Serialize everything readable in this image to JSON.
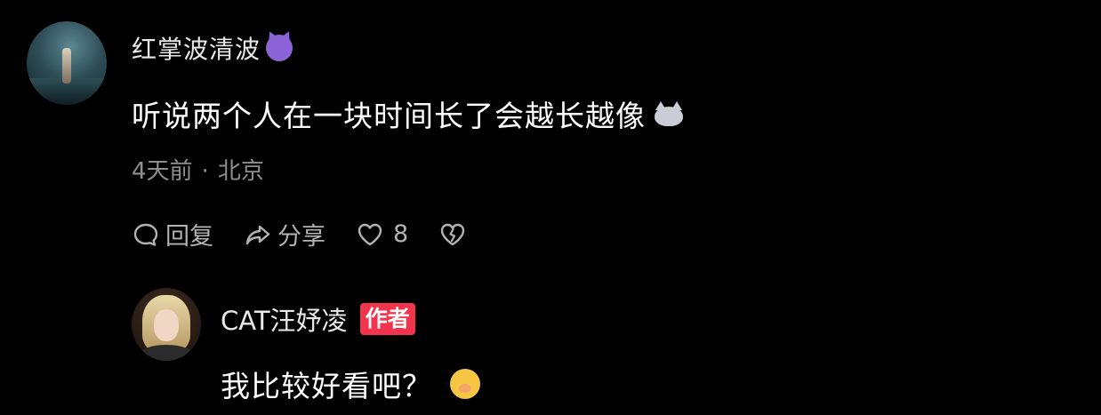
{
  "comment": {
    "username": "红掌波清波",
    "username_emoji": "smiling-devil-emoji",
    "text": "听说两个人在一块时间长了会越长越像",
    "text_emoji": "cat-emoji",
    "time": "4天前",
    "separator": "·",
    "location": "北京",
    "actions": {
      "reply_label": "回复",
      "share_label": "分享",
      "like_count": "8"
    }
  },
  "reply": {
    "username": "CAT汪妤凌",
    "badge": "作者",
    "text": "我比较好看吧？",
    "text_emoji": "shushing-face-emoji"
  },
  "colors": {
    "background": "#000000",
    "text_primary": "#ffffff",
    "text_secondary": "#8f8f8f",
    "action_gray": "#b3b3b3",
    "author_badge": "#f2354d"
  }
}
